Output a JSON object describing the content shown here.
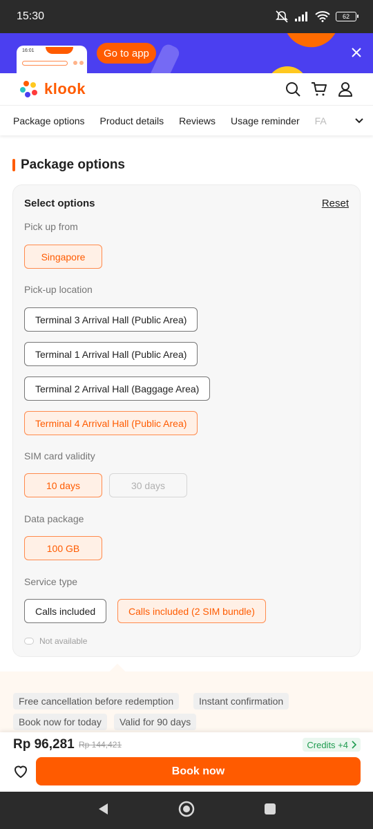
{
  "status_bar": {
    "time": "15:30",
    "battery": "62"
  },
  "banner": {
    "phone_time": "16:01",
    "cta_label": "Go to app"
  },
  "header": {
    "logo_text": "klook"
  },
  "tabs": [
    {
      "label": "Package options"
    },
    {
      "label": "Product details"
    },
    {
      "label": "Reviews"
    },
    {
      "label": "Usage reminder"
    },
    {
      "label": "FA"
    }
  ],
  "section": {
    "title": "Package options"
  },
  "options": {
    "title": "Select options",
    "reset_label": "Reset",
    "groups": [
      {
        "label": "Pick up from",
        "choices": [
          {
            "label": "Singapore",
            "state": "selected"
          }
        ]
      },
      {
        "label": "Pick-up location",
        "choices": [
          {
            "label": "Terminal 3 Arrival Hall (Public Area)",
            "state": "default"
          },
          {
            "label": "Terminal 1 Arrival Hall (Public Area)",
            "state": "default"
          },
          {
            "label": "Terminal 2 Arrival Hall (Baggage Area)",
            "state": "default"
          },
          {
            "label": "Terminal 4 Arrival Hall (Public Area)",
            "state": "selected"
          }
        ]
      },
      {
        "label": "SIM card validity",
        "choices": [
          {
            "label": "10 days",
            "state": "selected"
          },
          {
            "label": "30 days",
            "state": "disabled"
          }
        ]
      },
      {
        "label": "Data package",
        "choices": [
          {
            "label": "100 GB",
            "state": "selected"
          }
        ]
      },
      {
        "label": "Service type",
        "choices": [
          {
            "label": "Calls included",
            "state": "default"
          },
          {
            "label": "Calls included (2 SIM bundle)",
            "state": "selected"
          }
        ]
      }
    ],
    "legend": "Not available"
  },
  "tags": [
    {
      "label": "Free cancellation before redemption"
    },
    {
      "label": "Instant confirmation"
    },
    {
      "label": "Book now for today"
    },
    {
      "label": "Valid for 90 days"
    }
  ],
  "footer": {
    "price": "Rp 96,281",
    "old_price": "Rp 144,421",
    "credits": "Credits +4",
    "book_label": "Book now"
  },
  "colors": {
    "brand": "#ff5b00",
    "banner": "#4b3ff0",
    "selected_bg": "#fff0e6",
    "credits_green": "#1e9b4f"
  }
}
